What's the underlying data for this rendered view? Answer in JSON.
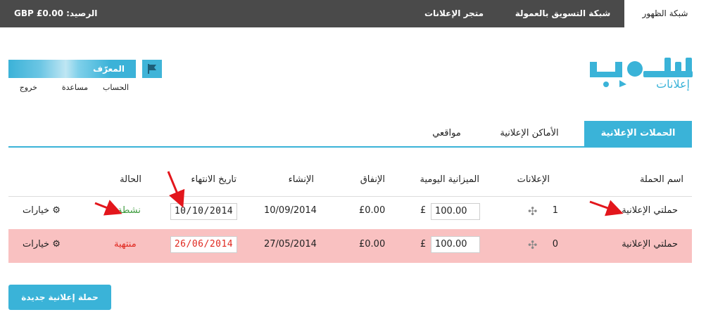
{
  "topbar": {
    "tabs": [
      {
        "label": "شبكة الظهور",
        "active": true
      },
      {
        "label": "شبكة التسويق بالعمولة",
        "active": false
      },
      {
        "label": "متجر الإعلانات",
        "active": false
      }
    ],
    "balance": "الرصيد: GBP £0.00"
  },
  "logo": {
    "subtitle": "إعلانات"
  },
  "user": {
    "label": "المعرّف",
    "links": [
      "الحساب",
      "مساعدة",
      "خروج"
    ]
  },
  "section_tabs": [
    {
      "label": "الحملات الإعلانية",
      "active": true
    },
    {
      "label": "الأماكن الإعلانية",
      "active": false
    },
    {
      "label": "مواقعي",
      "active": false
    }
  ],
  "table": {
    "headers": [
      "اسم الحملة",
      "الإعلانات",
      "الميزانية اليومية",
      "الإنفاق",
      "الإنشاء",
      "تاريخ الانتهاء",
      "الحالة"
    ],
    "rows": [
      {
        "name": "حملتي الإعلانية",
        "ads": "1",
        "currency": "£",
        "budget": "100.00",
        "spend": "£0.00",
        "created": "10/09/2014",
        "expiry": "10/10/2014",
        "status": "نشطة",
        "options": "خيارات"
      },
      {
        "name": "حملتي الإعلانية",
        "ads": "0",
        "currency": "£",
        "budget": "100.00",
        "spend": "£0.00",
        "created": "27/05/2014",
        "expiry": "26/06/2014",
        "status": "منتهية",
        "options": "خيارات"
      }
    ]
  },
  "new_campaign_button": "حملة إعلانية جديدة",
  "colors": {
    "accent": "#3ab3d8",
    "topbar": "#4a4a4a",
    "expired_row": "#f9c1c1",
    "active_status": "#3a9a3a",
    "ended_status": "#e0281f",
    "annotation": "#e3161c"
  }
}
